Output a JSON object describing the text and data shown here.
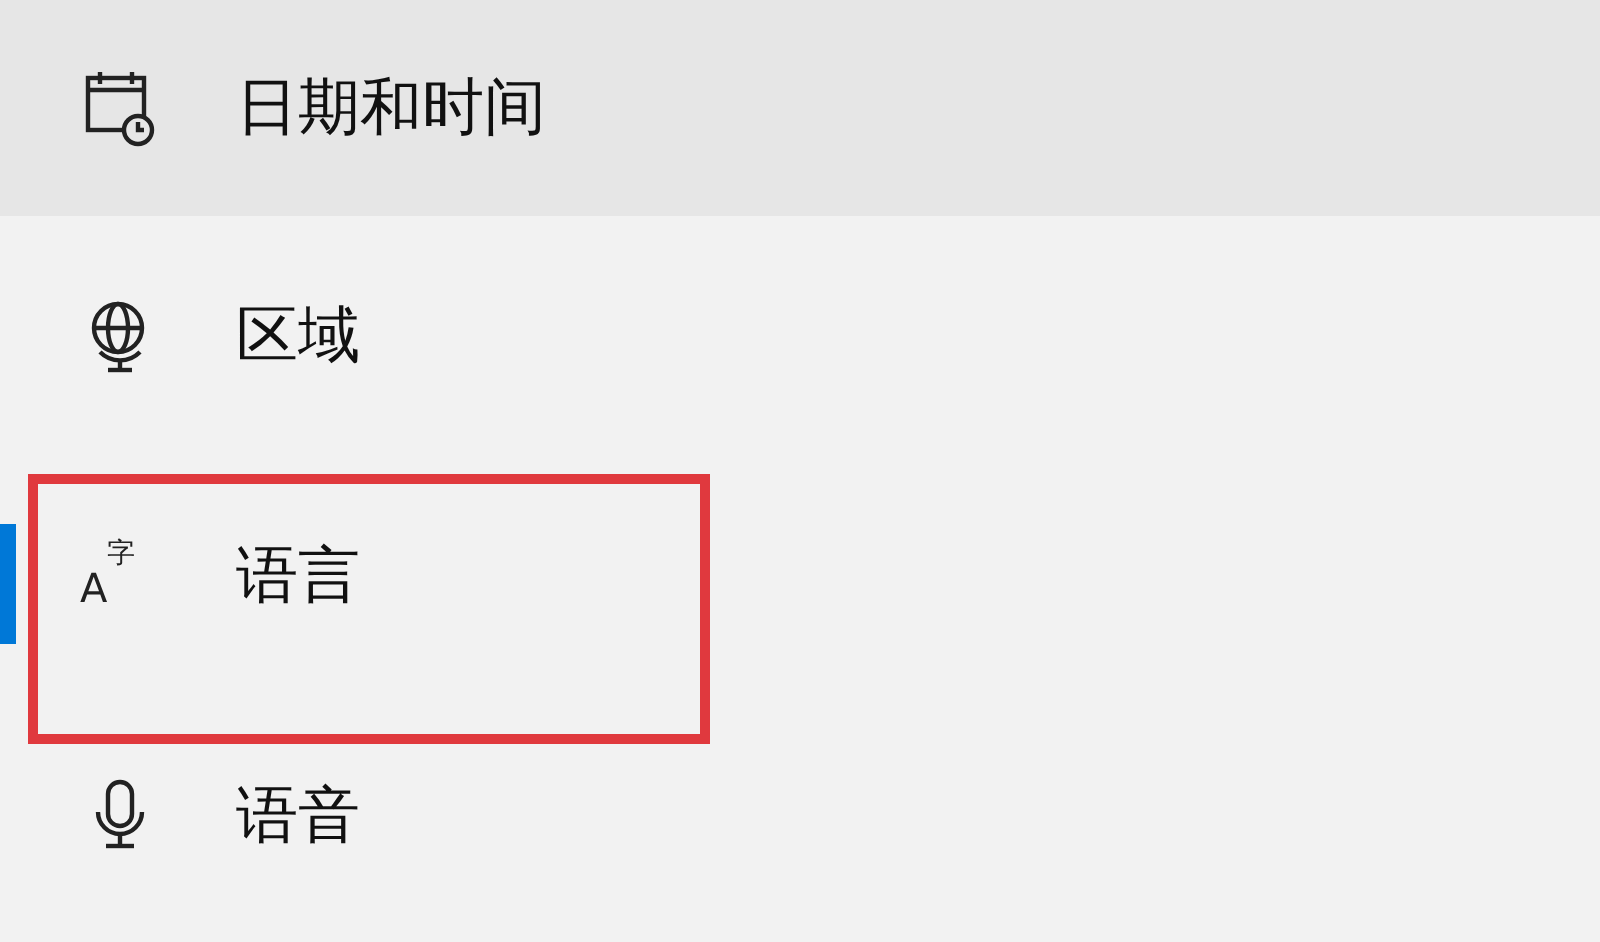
{
  "sidebar": {
    "items": [
      {
        "kind": "calendar-clock",
        "label": "日期和时间",
        "hovered": true,
        "selected": false,
        "annotated": false
      },
      {
        "kind": "globe",
        "label": "区域",
        "hovered": false,
        "selected": false,
        "annotated": false
      },
      {
        "kind": "language",
        "label": "语言",
        "icon_glyphs": [
          "A",
          "字"
        ],
        "hovered": false,
        "selected": true,
        "annotated": true
      },
      {
        "kind": "microphone",
        "label": "语音",
        "hovered": false,
        "selected": false,
        "annotated": false
      }
    ]
  }
}
